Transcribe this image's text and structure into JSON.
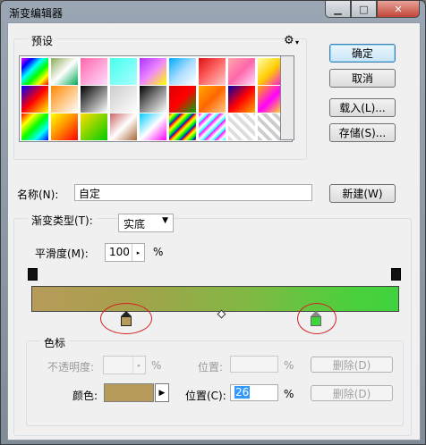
{
  "window": {
    "title": "渐变编辑器",
    "min_glyph": "▁",
    "max_glyph": "□",
    "close_glyph": "✕"
  },
  "presets": {
    "label": "预设",
    "gear_glyph": "⚙"
  },
  "buttons": {
    "ok": "确定",
    "cancel": "取消",
    "load": "载入(L)...",
    "save": "存储(S)...",
    "new": "新建(W)"
  },
  "name": {
    "label": "名称(N):",
    "value": "自定"
  },
  "gradient": {
    "type_label": "渐变类型(T):",
    "type_value": "实底",
    "smoothness_label": "平滑度(M):",
    "smoothness_value": "100",
    "percent": "%",
    "colors": {
      "left": "#b79b5a",
      "right": "#3fd33e"
    },
    "color_stop_positions": [
      0.26,
      0.86
    ]
  },
  "stops": {
    "label": "色标",
    "opacity_label": "不透明度:",
    "opacity_value": "",
    "position_label_1": "位置:",
    "position_value_1": "",
    "delete_1": "删除(D)",
    "color_label": "颜色:",
    "color_value": "#b79b5a",
    "position_label_2": "位置(C):",
    "position_value_2": "26",
    "delete_2": "删除(D)"
  }
}
